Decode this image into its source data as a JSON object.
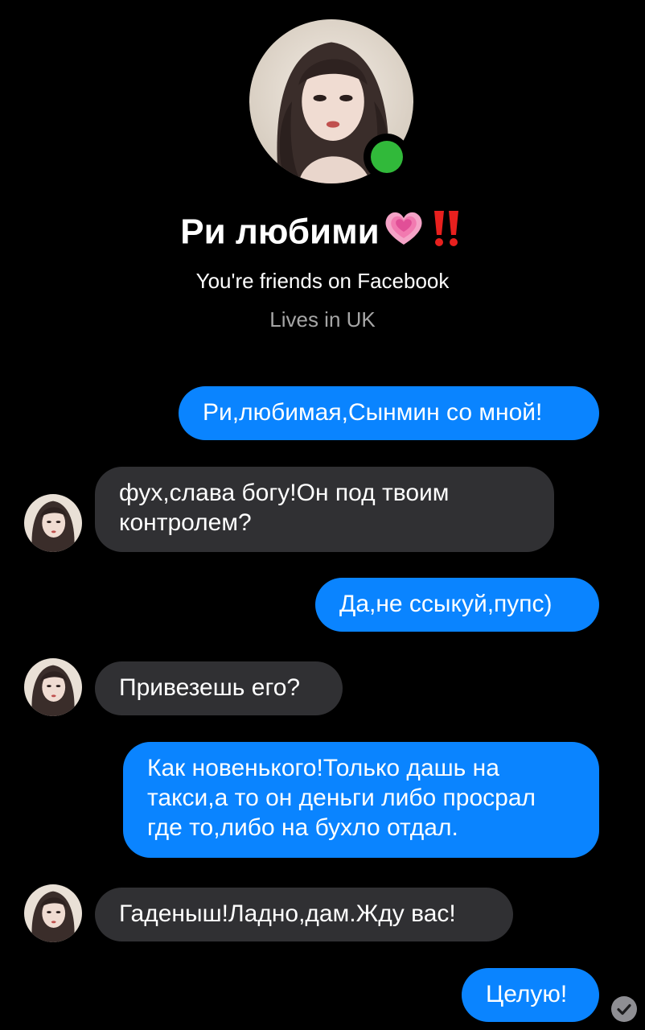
{
  "colors": {
    "background": "#000000",
    "outgoing_bubble": "#0a84ff",
    "incoming_bubble": "#303033",
    "online_indicator": "#31b93a",
    "secondary_text": "#a6a6a6",
    "seen_indicator": "#8e8e93"
  },
  "profile": {
    "name": "Ри любими",
    "name_emojis": [
      "growing-heart-emoji",
      "double-exclamation-emoji"
    ],
    "friends_line": "You're friends on Facebook",
    "lives_line": "Lives in UK",
    "status": "online"
  },
  "messages": [
    {
      "direction": "outgoing",
      "text": "Ри,любимая,Сынмин со мной!"
    },
    {
      "direction": "incoming",
      "text": "фух,слава богу!Он под твоим контролем?"
    },
    {
      "direction": "outgoing",
      "text": "Да,не ссыкуй,пупс)"
    },
    {
      "direction": "incoming",
      "text": "Привезешь его?"
    },
    {
      "direction": "outgoing",
      "text": "Как новенького!Только дашь на такси,а то он деньги либо просрал где то,либо на бухло отдал."
    },
    {
      "direction": "incoming",
      "text": "Гаденыш!Ладно,дам.Жду вас!"
    },
    {
      "direction": "outgoing",
      "text": "Целую!"
    }
  ],
  "seen_icon": "check-circle-icon"
}
